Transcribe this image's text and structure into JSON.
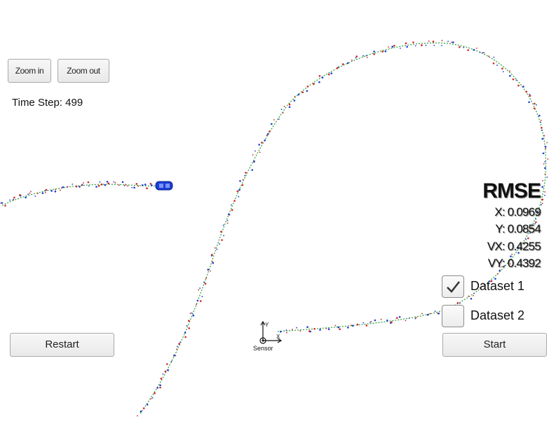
{
  "toolbar": {
    "zoom_in_label": "Zoom in",
    "zoom_out_label": "Zoom out"
  },
  "time_step": "Time Step: 499",
  "rmse": {
    "title": "RMSE",
    "x": "X: 0.0969",
    "y": "Y: 0.0854",
    "vx": "VX: 0.4255",
    "vy": "VY: 0.4392"
  },
  "datasets": [
    {
      "label": "Dataset 1",
      "checked": true
    },
    {
      "label": "Dataset 2",
      "checked": false
    }
  ],
  "controls": {
    "restart_label": "Restart",
    "start_label": "Start"
  },
  "sensor": {
    "label": "Sensor",
    "axis_x": "X",
    "axis_y": "Y"
  },
  "colors": {
    "ground_truth": "#2e9e3a",
    "lidar": "#d62020",
    "radar": "#1a3fd6",
    "car": "#1a3fd6"
  }
}
